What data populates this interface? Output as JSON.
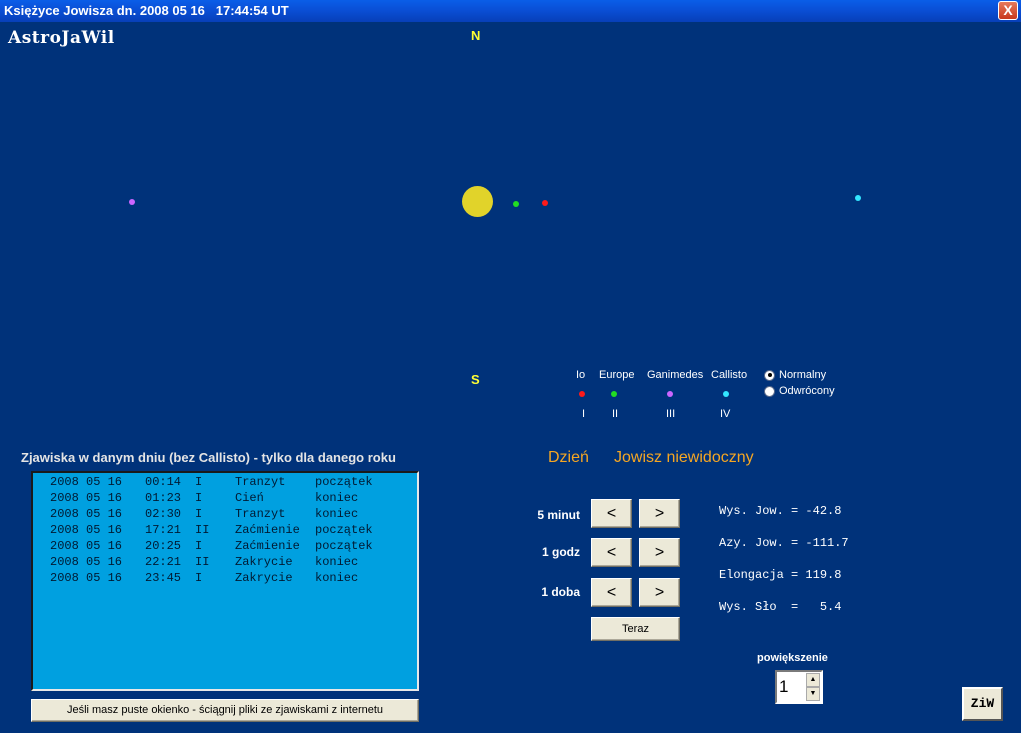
{
  "window": {
    "title": "Księżyce Jowisza dn. 2008 05 16   17:44:54 UT",
    "close_label": "X"
  },
  "app_name": "AstroJaWil",
  "sky": {
    "north_label": "N",
    "south_label": "S",
    "jupiter_color": "#e1d32a",
    "moons": [
      {
        "name": "Io",
        "color": "#ff1a1a"
      },
      {
        "name": "Europe",
        "color": "#22dd22"
      },
      {
        "name": "Ganimedes",
        "color": "#cc66ff"
      },
      {
        "name": "Callisto",
        "color": "#33e6ff"
      }
    ]
  },
  "legend": [
    {
      "label": "Io",
      "roman": "I",
      "color": "#ff1a1a"
    },
    {
      "label": "Europe",
      "roman": "II",
      "color": "#22dd22"
    },
    {
      "label": "Ganimedes",
      "roman": "III",
      "color": "#cc66ff"
    },
    {
      "label": "Callisto",
      "roman": "IV",
      "color": "#33e6ff"
    }
  ],
  "orientation": {
    "options": [
      {
        "label": "Normalny",
        "selected": true
      },
      {
        "label": "Odwrócony",
        "selected": false
      }
    ]
  },
  "events": {
    "heading": "Zjawiska w danym dniu (bez Callisto) - tylko dla danego roku",
    "rows": [
      {
        "date": "2008 05 16",
        "time": "00:14",
        "moon": "I",
        "event": "Tranzyt",
        "phase": "początek"
      },
      {
        "date": "2008 05 16",
        "time": "01:23",
        "moon": "I",
        "event": "Cień",
        "phase": "koniec"
      },
      {
        "date": "2008 05 16",
        "time": "02:30",
        "moon": "I",
        "event": "Tranzyt",
        "phase": "koniec"
      },
      {
        "date": "2008 05 16",
        "time": "17:21",
        "moon": "II",
        "event": "Zaćmienie",
        "phase": "początek"
      },
      {
        "date": "2008 05 16",
        "time": "20:25",
        "moon": "I",
        "event": "Zaćmienie",
        "phase": "początek"
      },
      {
        "date": "2008 05 16",
        "time": "22:21",
        "moon": "II",
        "event": "Zakrycie",
        "phase": "koniec"
      },
      {
        "date": "2008 05 16",
        "time": "23:45",
        "moon": "I",
        "event": "Zakrycie",
        "phase": "koniec"
      }
    ],
    "fetch_button": "Jeśli masz puste okienko - ściągnij pliki ze zjawiskami  z internetu"
  },
  "status": {
    "day": "Dzień",
    "visibility": "Jowisz niewidoczny"
  },
  "steps": [
    {
      "label": "5 minut",
      "back": "<",
      "forward": ">"
    },
    {
      "label": "1 godz",
      "back": "<",
      "forward": ">"
    },
    {
      "label": "1 doba",
      "back": "<",
      "forward": ">"
    }
  ],
  "now_button": "Teraz",
  "info": {
    "altitude": "Wys. Jow. = -42.8",
    "azimuth": "Azy. Jow. = -111.7",
    "elongation": "Elongacja = 119.8",
    "sun_altitude": "Wys. Sło  =   5.4"
  },
  "zoom": {
    "label": "powiększenie",
    "value": "1"
  },
  "ziw_button": "ZiW"
}
